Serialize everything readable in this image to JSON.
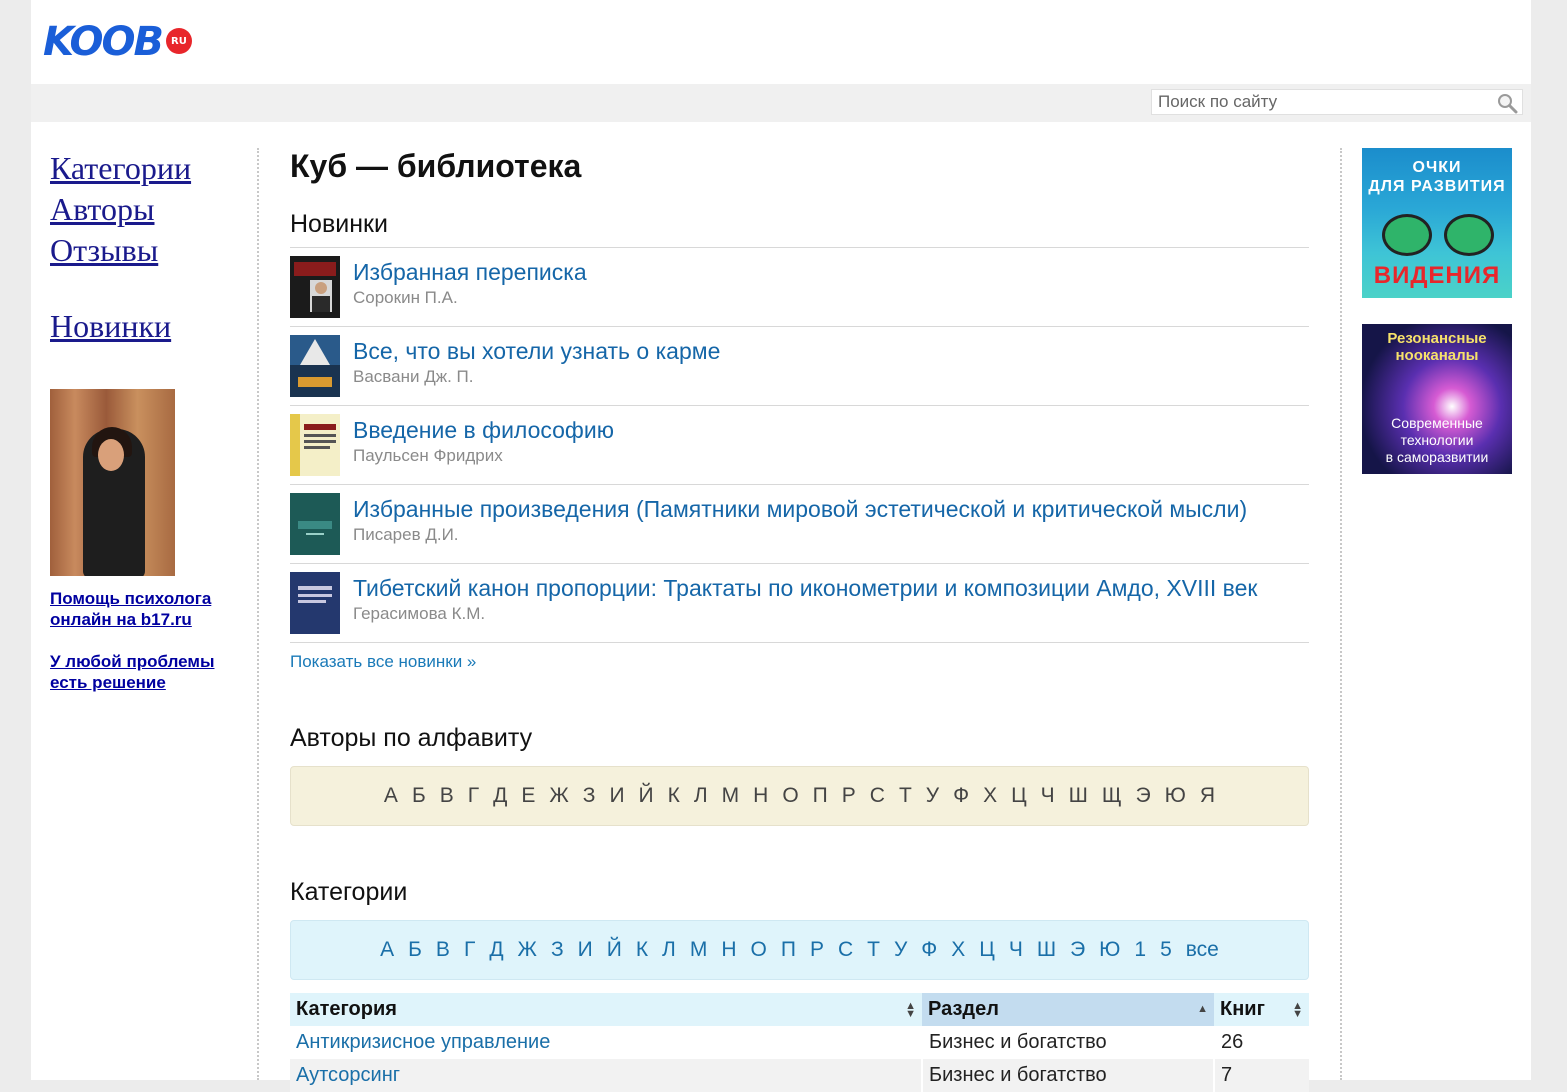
{
  "header": {
    "logo_text": "KOOB",
    "logo_badge": "RU",
    "search_placeholder": "Поиск по сайту"
  },
  "sidebar": {
    "nav": [
      "Категории",
      "Авторы",
      "Отзывы"
    ],
    "new_link": "Новинки",
    "promo_links": [
      "Помощь психолога онлайн на b17.ru",
      "У любой проблемы есть решение"
    ]
  },
  "main": {
    "page_title": "Куб — библиотека",
    "new_heading": "Новинки",
    "books": [
      {
        "title": "Избранная переписка",
        "author": "Сорокин П.А."
      },
      {
        "title": "Все, что вы хотели узнать о карме",
        "author": "Васвани Дж. П."
      },
      {
        "title": "Введение в философию",
        "author": "Паульсен Фридрих"
      },
      {
        "title": "Избранные произведения (Памятники мировой эстетической и критической мысли)",
        "author": "Писарев Д.И."
      },
      {
        "title": "Тибетский канон пропорции: Трактаты по иконометрии и композиции Амдо, XVIII век",
        "author": "Герасимова К.М."
      }
    ],
    "show_all": "Показать все новинки »",
    "authors_heading": "Авторы по алфавиту",
    "authors_letters": [
      "А",
      "Б",
      "В",
      "Г",
      "Д",
      "Е",
      "Ж",
      "З",
      "И",
      "Й",
      "К",
      "Л",
      "М",
      "Н",
      "О",
      "П",
      "Р",
      "С",
      "Т",
      "У",
      "Ф",
      "Х",
      "Ц",
      "Ч",
      "Ш",
      "Щ",
      "Э",
      "Ю",
      "Я"
    ],
    "categories_heading": "Категории",
    "category_letters": [
      "А",
      "Б",
      "В",
      "Г",
      "Д",
      "Ж",
      "З",
      "И",
      "Й",
      "К",
      "Л",
      "М",
      "Н",
      "О",
      "П",
      "Р",
      "С",
      "Т",
      "У",
      "Ф",
      "Х",
      "Ц",
      "Ч",
      "Ш",
      "Э",
      "Ю",
      "1",
      "5",
      "все"
    ],
    "table": {
      "headers": [
        "Категория",
        "Раздел",
        "Книг"
      ],
      "rows": [
        {
          "category": "Антикризисное управление",
          "section": "Бизнес и богатство",
          "count": "26"
        },
        {
          "category": "Аутсорсинг",
          "section": "Бизнес и богатство",
          "count": "7"
        }
      ]
    }
  },
  "ads": {
    "ad1": {
      "line1": "ОЧКИ",
      "line2": "ДЛЯ РАЗВИТИЯ",
      "line3": "ВИДЕНИЯ"
    },
    "ad2": {
      "line1": "Резонансные",
      "line2": "нооканалы",
      "line3": "Современные",
      "line4": "технологии",
      "line5": "в саморазвитии"
    }
  },
  "colors": {
    "link_blue": "#1566a8",
    "sidebar_link": "#1a1a8c",
    "authors_bar": "#f5f1dc",
    "categories_bar": "#dff4fb",
    "logo_blue": "#1a5ed8",
    "logo_red": "#e8262b"
  }
}
